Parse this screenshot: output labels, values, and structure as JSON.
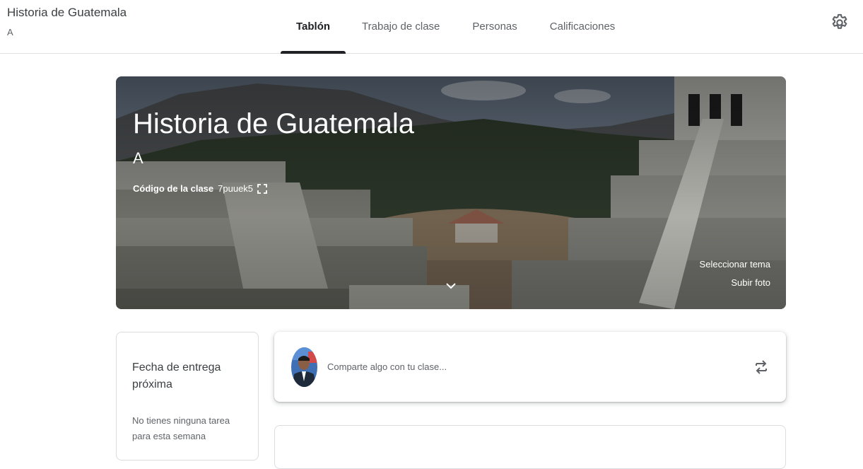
{
  "header": {
    "course_title": "Historia de Guatemala",
    "course_section": "A",
    "tabs": [
      {
        "label": "Tablón",
        "active": true
      },
      {
        "label": "Trabajo de clase",
        "active": false
      },
      {
        "label": "Personas",
        "active": false
      },
      {
        "label": "Calificaciones",
        "active": false
      }
    ],
    "settings_icon": "gear-icon"
  },
  "banner": {
    "title": "Historia de Guatemala",
    "section": "A",
    "code_label": "Código de la clase",
    "code_value": "7puuek5",
    "select_theme": "Seleccionar tema",
    "upload_photo": "Subir foto",
    "expand_icon": "chevron-down-icon"
  },
  "upcoming": {
    "heading": "Fecha de entrega próxima",
    "body": "No tienes ninguna tarea para esta semana"
  },
  "share": {
    "placeholder": "Comparte algo con tu clase...",
    "repost_icon": "repost-icon"
  },
  "colors": {
    "text_primary": "#202124",
    "text_secondary": "#5f6368",
    "divider": "#e0e0e0"
  }
}
